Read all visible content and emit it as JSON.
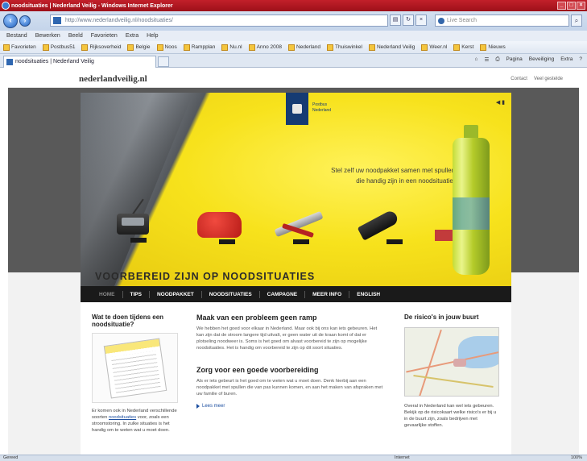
{
  "browser": {
    "title": "noodsituaties | Nederland Veilig - Windows Internet Explorer",
    "address_url": "http://www.nederlandveilig.nl/noodsituaties/",
    "search_placeholder": "Live Search",
    "menu": [
      "Bestand",
      "Bewerken",
      "Beeld",
      "Favorieten",
      "Extra",
      "Help"
    ],
    "favorites": [
      "Favorieten",
      "Postbus51",
      "Rijksoverheid",
      "Belgie",
      "Noos",
      "Rampplan",
      "Nu.nl",
      "Anno 2008",
      "Nederland",
      "Thuiswinkel",
      "Nederland Veilig",
      "Weer.nl",
      "Kerst",
      "Nieuws"
    ],
    "tab_title": "noodsituaties | Nederland Veilig",
    "command_bar": [
      "Pagina",
      "Beveiliging",
      "Extra"
    ],
    "status_left": "Gereed",
    "status_zone": "Internet",
    "status_zoom": "100%"
  },
  "site": {
    "logo": "nederlandveilig.nl",
    "header_links": [
      "Contact",
      "Veel gestelde"
    ],
    "rijks_line1": "Postbus",
    "rijks_line2": "Nederland",
    "hero_tagline_line1": "Stel zelf uw noodpakket samen met spullen",
    "hero_tagline_line2": "die handig zijn in een noodsituatie.",
    "hero_title": "VOORBEREID ZIJN OP NOODSITUATIES",
    "nav": [
      "HOME",
      "TIPS",
      "NOODPAKKET",
      "NOODSITUATIES",
      "CAMPAGNE",
      "MEER INFO",
      "ENGLISH"
    ],
    "left": {
      "heading": "Wat te doen tijdens een noodsituatie?",
      "text_before_link": "Er komen ook in Nederland verschillende soorten",
      "link": "noodsituaties",
      "text_after_link": "voor, zoals een stroomstoring. In zulke situaties is het handig om te weten wat u moet doen."
    },
    "middle": {
      "heading1": "Maak van een probleem geen ramp",
      "para1": "We hebben het goed voor elkaar in Nederland. Maar ook bij ons kan iets gebeuren. Het kan zijn dat de stroom langere tijd uitvalt, er geen water uit de kraan komt of dat er plotseling noodweer is. Soms is het goed om alvast voorbereid te zijn op mogelijke noodsituaties. Het is handig om voorbereid te zijn op dit soort situaties.",
      "heading2": "Zorg voor een goede voorbereiding",
      "para2": "Als er iets gebeurt is het goed om te weten wat u moet doen. Denk hierbij aan een noodpakket met spullen die van pas kunnen komen, en aan het maken van afspraken met uw familie of buren.",
      "more_link": "Lees meer"
    },
    "right": {
      "heading": "De risico's in jouw buurt",
      "text": "Overal in Nederland kan wel iets gebeuren. Bekijk op de risicokaart welke risico's er bij u in de buurt zijn, zoals bedrijven met gevaarlijke stoffen."
    }
  }
}
